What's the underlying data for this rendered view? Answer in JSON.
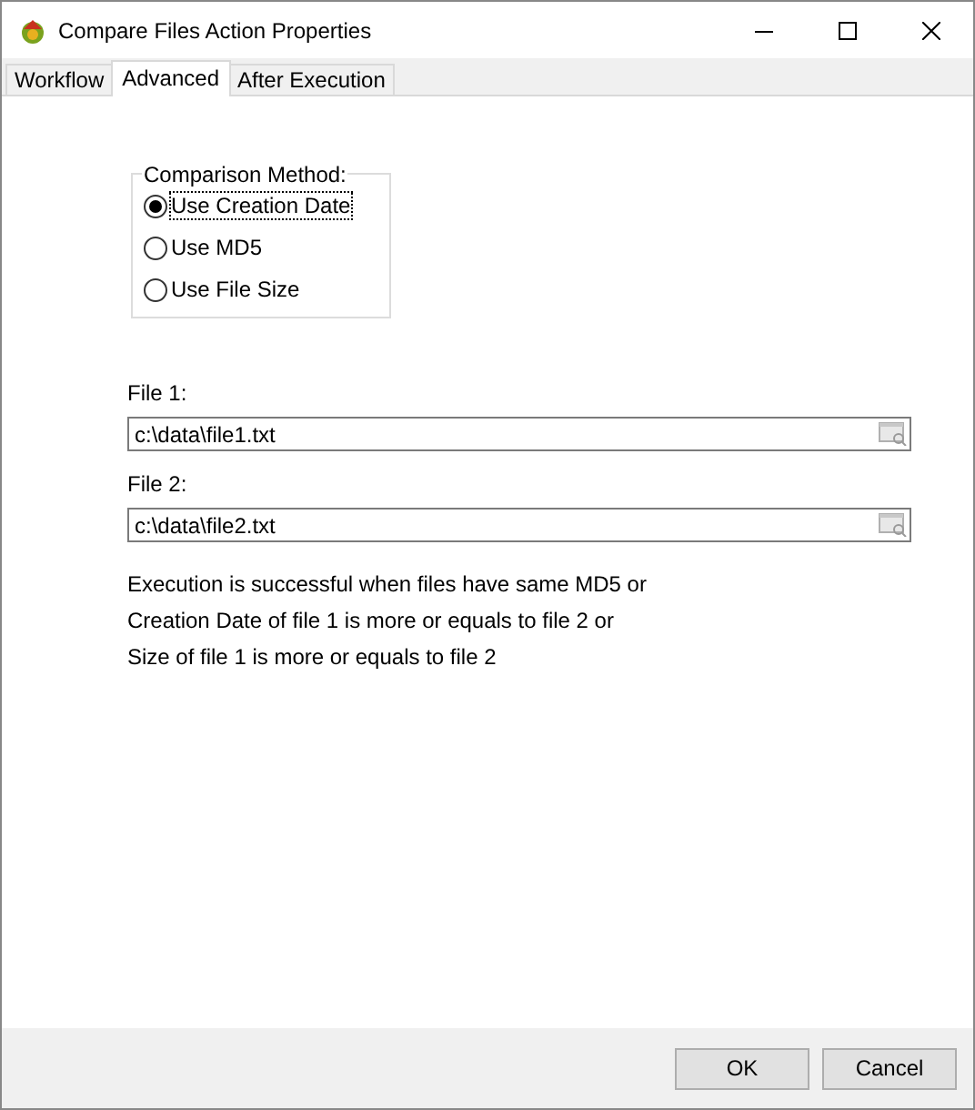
{
  "window": {
    "title": "Compare Files Action Properties"
  },
  "tabs": [
    {
      "label": "Workflow",
      "selected": false
    },
    {
      "label": "Advanced",
      "selected": true
    },
    {
      "label": "After Execution",
      "selected": false
    }
  ],
  "comparison_method": {
    "title": "Comparison Method:",
    "options": [
      {
        "label": "Use Creation Date",
        "selected": true
      },
      {
        "label": "Use MD5",
        "selected": false
      },
      {
        "label": "Use File Size",
        "selected": false
      }
    ]
  },
  "files": [
    {
      "label": "File 1:",
      "value": "c:\\data\\file1.txt"
    },
    {
      "label": "File 2:",
      "value": "c:\\data\\file2.txt"
    }
  ],
  "description": [
    "Execution is successful when files have same MD5 or",
    "Creation Date of file 1 is more or equals to file 2 or",
    "Size of file 1 is more or equals to file 2"
  ],
  "buttons": [
    "OK",
    "Cancel"
  ]
}
